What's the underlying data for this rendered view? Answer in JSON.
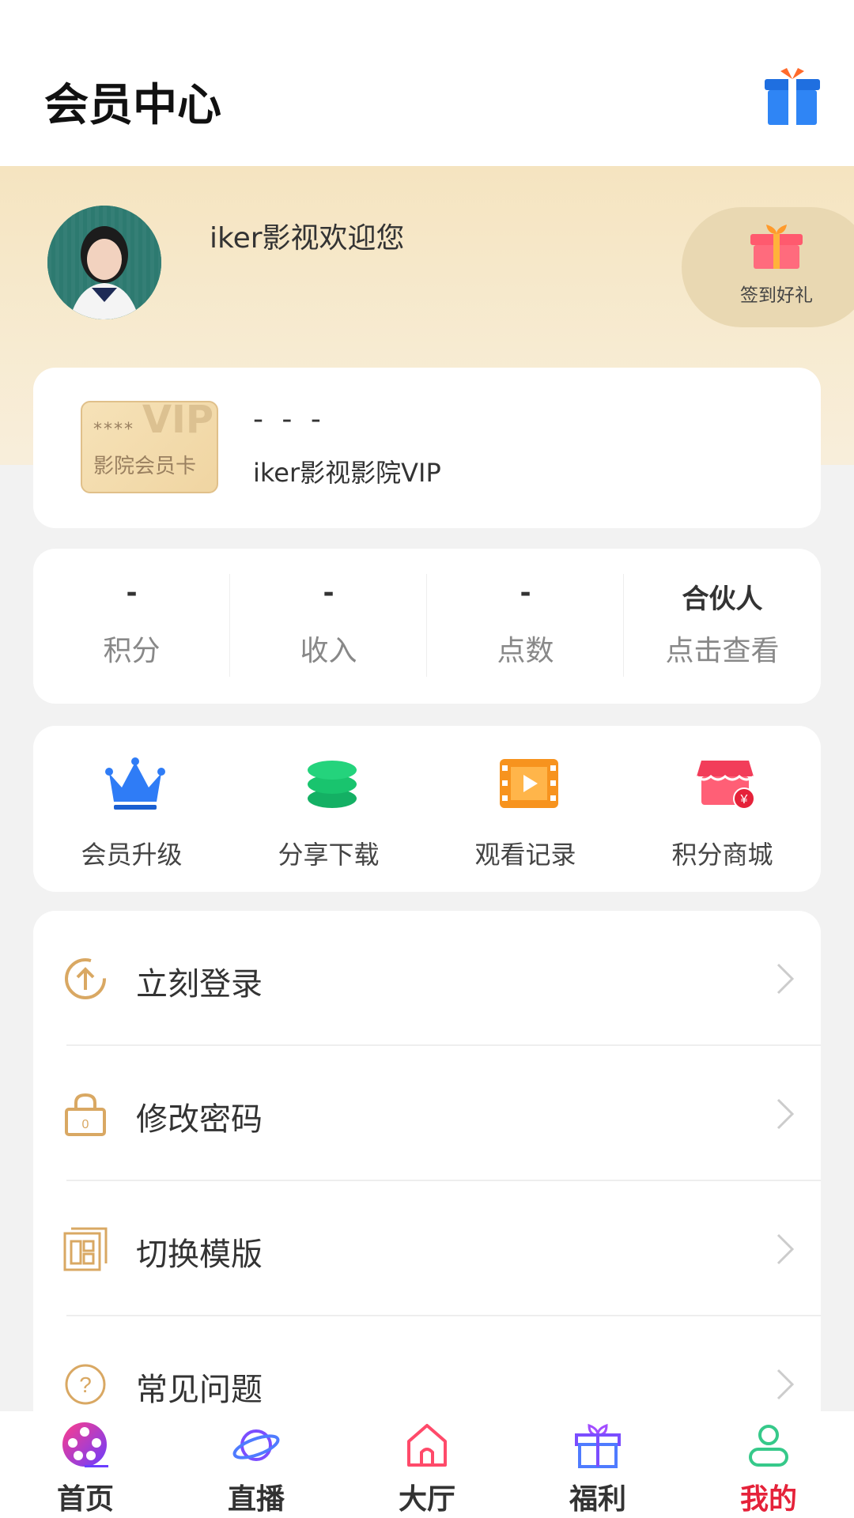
{
  "header": {
    "title": "会员中心",
    "gift_icon": "gift-box-icon"
  },
  "profile": {
    "welcome": "iker影视欢迎您",
    "checkin_label": "签到好礼",
    "checkin_icon": "gift-icon"
  },
  "vip": {
    "badge_stars": "****",
    "badge_word": "VIP",
    "badge_name": "影院会员卡",
    "number": "- - -",
    "subtitle": "iker影视影院VIP"
  },
  "stats": [
    {
      "value": "-",
      "label": "积分"
    },
    {
      "value": "-",
      "label": "收入"
    },
    {
      "value": "-",
      "label": "点数"
    },
    {
      "value": "合伙人",
      "label": "点击查看"
    }
  ],
  "quick_actions": [
    {
      "label": "会员升级",
      "icon": "crown-icon",
      "color": "#2f7cf6"
    },
    {
      "label": "分享下载",
      "icon": "coins-stack-icon",
      "color": "#19c46e"
    },
    {
      "label": "观看记录",
      "icon": "film-icon",
      "color": "#f7931e"
    },
    {
      "label": "积分商城",
      "icon": "shop-icon",
      "color": "#f23d5a"
    }
  ],
  "menu": [
    {
      "label": "立刻登录",
      "icon": "upload-circle-icon"
    },
    {
      "label": "修改密码",
      "icon": "lock-icon"
    },
    {
      "label": "切换模版",
      "icon": "template-icon"
    },
    {
      "label": "常见问题",
      "icon": "question-icon"
    }
  ],
  "tabbar": [
    {
      "label": "首页",
      "icon": "film-reel-icon"
    },
    {
      "label": "直播",
      "icon": "planet-icon"
    },
    {
      "label": "大厅",
      "icon": "home-icon"
    },
    {
      "label": "福利",
      "icon": "gift-icon"
    },
    {
      "label": "我的",
      "icon": "user-icon",
      "active": true
    }
  ],
  "colors": {
    "accent_active": "#e5223a",
    "menu_icon": "#d9a863",
    "hero_bg": "#f5e4c0"
  }
}
